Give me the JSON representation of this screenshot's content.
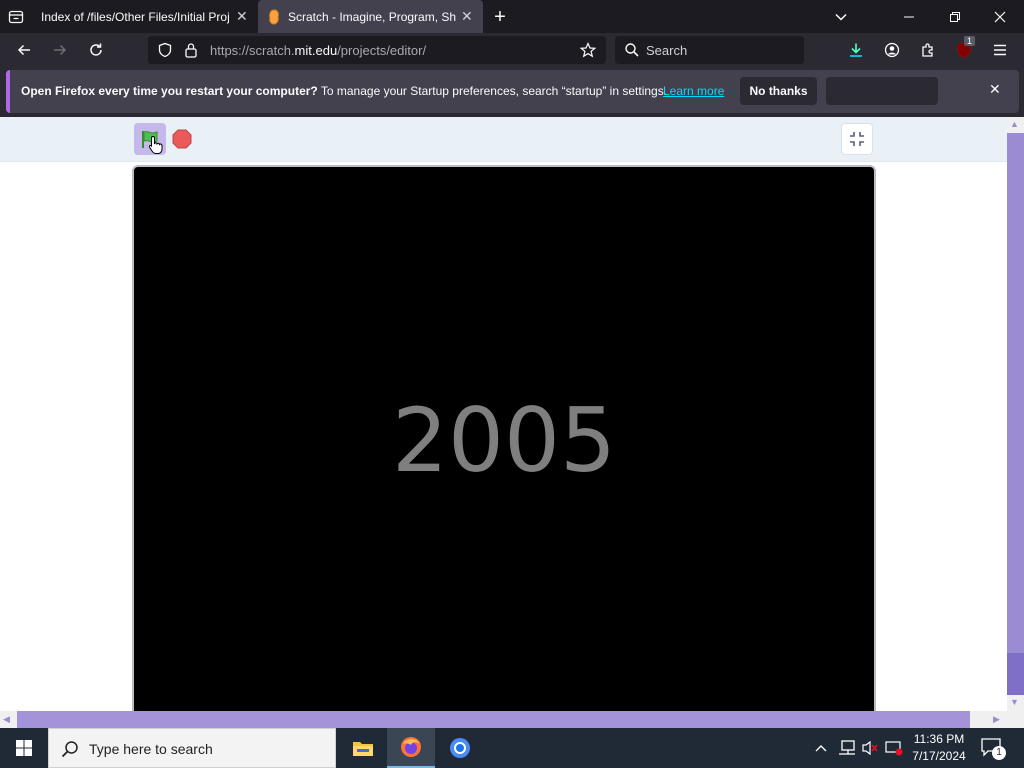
{
  "browser": {
    "tabs": [
      {
        "title": "Index of /files/Other Files/Initial Proj",
        "active": false
      },
      {
        "title": "Scratch - Imagine, Program, Sha",
        "active": true
      }
    ],
    "url": {
      "prefix": "https://scratch.",
      "host": "mit.edu",
      "path": "/projects/editor/"
    },
    "search_placeholder": "Search",
    "extension_badge": "1"
  },
  "notification": {
    "bold_text": "Open Firefox every time you restart your computer?",
    "text": " To manage your Startup preferences, search “startup” in settings.",
    "link": "Learn more",
    "dismiss_label": "No thanks"
  },
  "scratch": {
    "stage_text": "2005"
  },
  "taskbar": {
    "search_placeholder": "Type here to search",
    "time": "11:36 PM",
    "date": "7/17/2024",
    "notification_count": "1"
  },
  "colors": {
    "accent": "#b267e8",
    "link": "#00ddff",
    "scratch_header": "#e9f0f6",
    "flag_active": "#c5b8ea"
  }
}
